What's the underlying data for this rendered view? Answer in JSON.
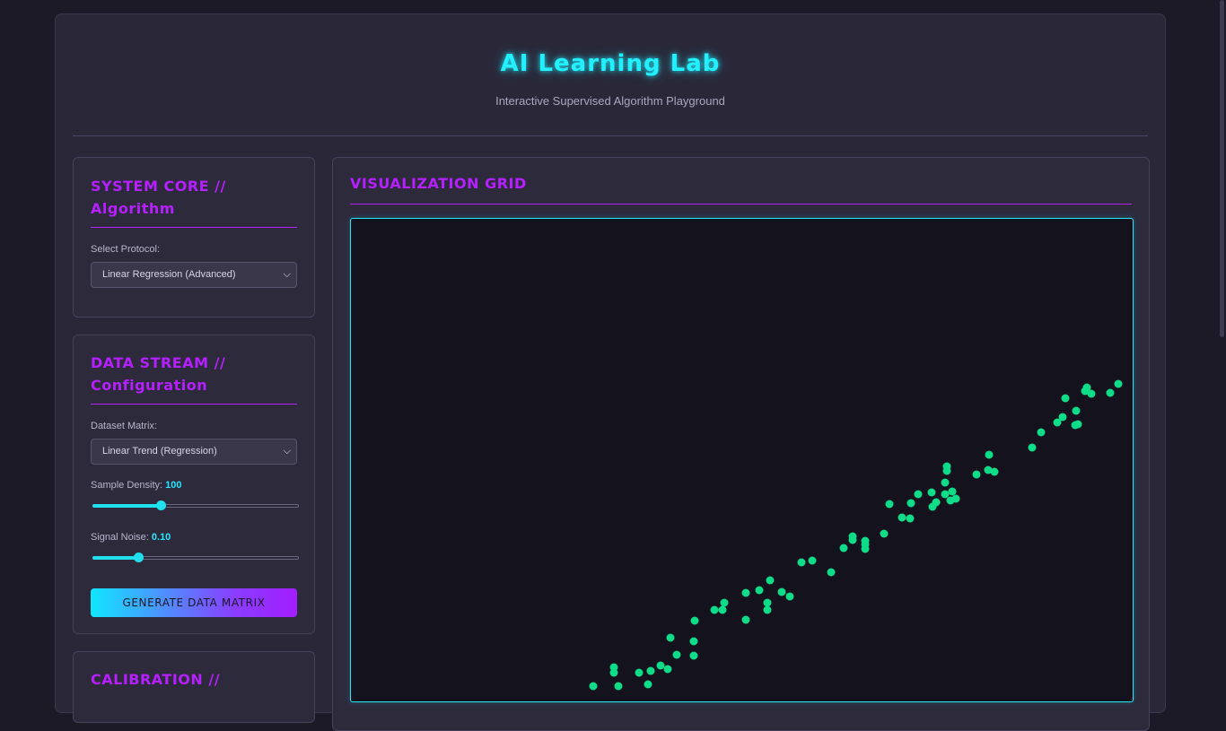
{
  "header": {
    "title": "AI Learning Lab",
    "subtitle": "Interactive Supervised Algorithm Playground"
  },
  "system_core": {
    "title_line1": "SYSTEM CORE //",
    "title_line2": "Algorithm",
    "protocol_label": "Select Protocol:",
    "protocol_value": "Linear Regression (Advanced)"
  },
  "data_stream": {
    "title_line1": "DATA STREAM //",
    "title_line2": "Configuration",
    "dataset_label": "Dataset Matrix:",
    "dataset_value": "Linear Trend (Regression)",
    "density_label": "Sample Density:",
    "density_value": "100",
    "density_fraction": 0.33,
    "noise_label": "Signal Noise:",
    "noise_value": "0.10",
    "noise_fraction": 0.22,
    "generate_label": "GENERATE DATA MATRIX"
  },
  "calibration": {
    "title_line1": "CALIBRATION //"
  },
  "visualization": {
    "title": "VISUALIZATION GRID"
  },
  "colors": {
    "title_glow": "#22f0ff",
    "accent_magenta": "#b61fff",
    "accent_cyan": "#1fe0ec",
    "point_color": "#0ddc88"
  },
  "chart_data": {
    "type": "scatter",
    "title": "",
    "xlabel": "",
    "ylabel": "",
    "grid": false,
    "series": [
      {
        "points": [
          [
            270,
            521
          ],
          [
            298,
            521
          ],
          [
            293,
            506
          ],
          [
            293,
            500
          ],
          [
            321,
            506
          ],
          [
            331,
            519
          ],
          [
            334,
            504
          ],
          [
            345,
            498
          ],
          [
            353,
            502
          ],
          [
            363,
            486
          ],
          [
            356,
            467
          ],
          [
            382,
            487
          ],
          [
            382,
            471
          ],
          [
            383,
            448
          ],
          [
            405,
            436
          ],
          [
            414,
            436
          ],
          [
            416,
            428
          ],
          [
            440,
            417
          ],
          [
            440,
            447
          ],
          [
            455,
            414
          ],
          [
            464,
            428
          ],
          [
            464,
            436
          ],
          [
            467,
            403
          ],
          [
            480,
            416
          ],
          [
            489,
            421
          ],
          [
            502,
            383
          ],
          [
            514,
            381
          ],
          [
            535,
            394
          ],
          [
            549,
            367
          ],
          [
            559,
            358
          ],
          [
            559,
            354
          ],
          [
            573,
            368
          ],
          [
            573,
            363
          ],
          [
            573,
            359
          ],
          [
            594,
            351
          ],
          [
            600,
            318
          ],
          [
            614,
            333
          ],
          [
            623,
            334
          ],
          [
            624,
            317
          ],
          [
            632,
            307
          ],
          [
            647,
            305
          ],
          [
            648,
            321
          ],
          [
            652,
            316
          ],
          [
            662,
            307
          ],
          [
            662,
            294
          ],
          [
            664,
            281
          ],
          [
            664,
            276
          ],
          [
            668,
            314
          ],
          [
            670,
            304
          ],
          [
            674,
            312
          ],
          [
            697,
            285
          ],
          [
            710,
            280
          ],
          [
            711,
            263
          ],
          [
            717,
            282
          ],
          [
            759,
            255
          ],
          [
            769,
            238
          ],
          [
            787,
            227
          ],
          [
            793,
            221
          ],
          [
            796,
            200
          ],
          [
            808,
            214
          ],
          [
            810,
            229
          ],
          [
            807,
            230
          ],
          [
            818,
            192
          ],
          [
            820,
            188
          ],
          [
            825,
            195
          ],
          [
            846,
            194
          ],
          [
            855,
            184
          ]
        ]
      }
    ]
  }
}
